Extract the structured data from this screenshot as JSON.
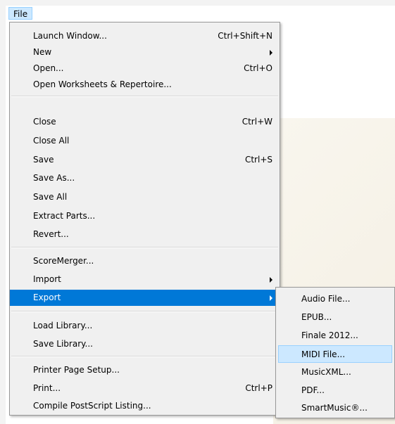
{
  "menubar": {
    "file_label": "File"
  },
  "file_menu": {
    "launch_window": {
      "label": "Launch Window...",
      "shortcut": "Ctrl+Shift+N"
    },
    "new": {
      "label": "New"
    },
    "open": {
      "label": "Open...",
      "shortcut": "Ctrl+O"
    },
    "open_worksheets": {
      "label": "Open Worksheets & Repertoire..."
    },
    "close": {
      "label": "Close",
      "shortcut": "Ctrl+W"
    },
    "close_all": {
      "label": "Close All"
    },
    "save": {
      "label": "Save",
      "shortcut": "Ctrl+S"
    },
    "save_as": {
      "label": "Save As..."
    },
    "save_all": {
      "label": "Save All"
    },
    "extract_parts": {
      "label": "Extract Parts..."
    },
    "revert": {
      "label": "Revert..."
    },
    "scoremerger": {
      "label": "ScoreMerger..."
    },
    "import": {
      "label": "Import"
    },
    "export": {
      "label": "Export"
    },
    "load_library": {
      "label": "Load Library..."
    },
    "save_library": {
      "label": "Save Library..."
    },
    "printer_page_setup": {
      "label": "Printer Page Setup..."
    },
    "print": {
      "label": "Print...",
      "shortcut": "Ctrl+P"
    },
    "compile_postscript": {
      "label": "Compile PostScript Listing..."
    }
  },
  "export_submenu": {
    "items": [
      {
        "label": "Audio File..."
      },
      {
        "label": "EPUB..."
      },
      {
        "label": "Finale 2012..."
      },
      {
        "label": "MIDI File..."
      },
      {
        "label": "MusicXML..."
      },
      {
        "label": "PDF..."
      },
      {
        "label": "SmartMusic®..."
      }
    ],
    "hovered_label": "MIDI File..."
  },
  "colors": {
    "menu_bg": "#f0f0f0",
    "active_highlight": "#0078d7",
    "hover_highlight": "#cce8ff"
  }
}
